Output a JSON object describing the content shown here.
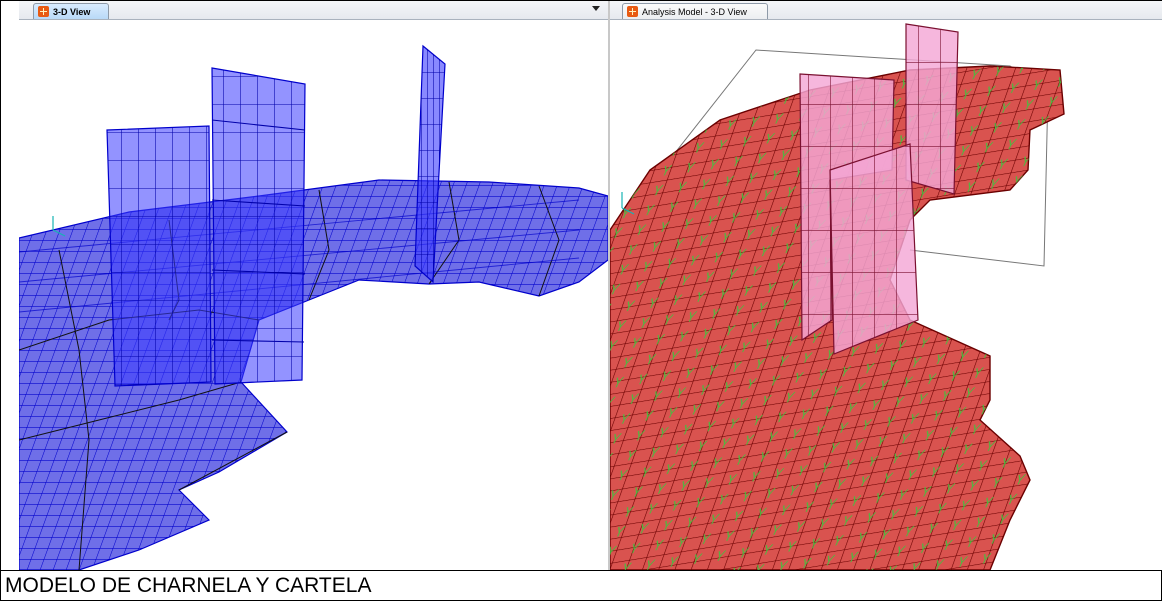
{
  "left_window": {
    "tab_label": "3-D View",
    "icon": "model-window-icon"
  },
  "right_window": {
    "tab_label": "Analysis Model - 3-D View",
    "icon": "model-window-icon"
  },
  "caption": "MODELO DE CHARNELA Y CARTELA",
  "colors": {
    "left_mesh_fill": "#3b3bff",
    "left_mesh_line": "#0000cc",
    "right_mesh_fill": "#d9534f",
    "right_mesh_line": "#6b0000",
    "right_wall_fill": "#f4a7d6",
    "support_marker": "#3ec43e"
  }
}
